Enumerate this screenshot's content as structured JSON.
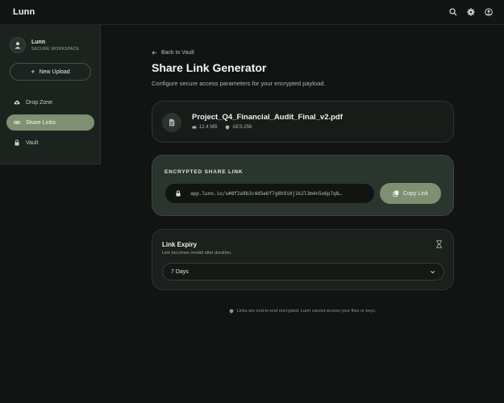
{
  "app": {
    "brand": "Lunn"
  },
  "topbar": {
    "icons": [
      "search-icon",
      "gear-icon",
      "account-icon"
    ]
  },
  "sidebar": {
    "profile": {
      "name": "Lunn",
      "subtitle": "SECURE WORKSPACE"
    },
    "new_upload_label": "New Upload",
    "items": [
      {
        "label": "Drop Zone",
        "icon": "cloud-upload-icon",
        "active": false
      },
      {
        "label": "Share Links",
        "icon": "link-icon",
        "active": true
      },
      {
        "label": "Vault",
        "icon": "lock-icon",
        "active": false
      }
    ]
  },
  "main": {
    "back_label": "Back to Vault",
    "title": "Share Link Generator",
    "subtitle": "Configure secure access parameters for your encrypted payload.",
    "file": {
      "name": "Project_Q4_Financial_Audit_Final_v2.pdf",
      "size": "12.4 MB",
      "encryption": "AES-256"
    },
    "share_link": {
      "label": "ENCRYPTED SHARE LINK",
      "url": "app.lunn.io/s#8f2a9b3c4d5e6f7g8h9i0j1k2l3m4n5o6p7q8…",
      "copy_label": "Copy Link"
    },
    "expiry": {
      "title": "Link Expiry",
      "subtitle": "Link becomes invalid after duration.",
      "selected": "7 Days"
    },
    "footnote": "Links are end-to-end encrypted. Lunn cannot access your files or keys."
  },
  "colors": {
    "background": "#111412",
    "accent": "#7f8f71",
    "card_highlight": "#2a352e"
  }
}
